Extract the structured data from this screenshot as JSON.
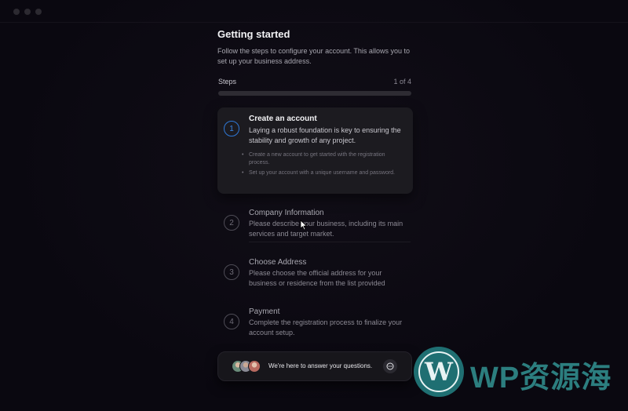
{
  "window": {
    "controls": [
      "close",
      "minimize",
      "maximize"
    ]
  },
  "header": {
    "title": "Getting started",
    "description": "Follow the steps to configure your account. This allows you to set up your business address."
  },
  "progress": {
    "label": "Steps",
    "count_text": "1 of 4",
    "current": 1,
    "total": 4,
    "fraction": 0.0
  },
  "steps": [
    {
      "number": "1",
      "title": "Create an account",
      "description": "Laying a robust foundation is key to ensuring the stability and growth of any project.",
      "bullets": [
        "Create a new account to get started with the registration process.",
        "Set up your account with a unique username and password."
      ],
      "active": true
    },
    {
      "number": "2",
      "title": "Company Information",
      "description": "Please describe your business, including its main services and target market.",
      "active": false
    },
    {
      "number": "3",
      "title": "Choose Address",
      "description": "Please choose the official address for your business or residence from the list provided",
      "active": false
    },
    {
      "number": "4",
      "title": "Payment",
      "description": "Complete the registration process to finalize your account setup.",
      "active": false
    }
  ],
  "help": {
    "text": "We're here to answer your questions.",
    "icon": "chat-bubble-icon"
  },
  "watermark": {
    "text": "WP资源海",
    "logo_letter": "W"
  },
  "colors": {
    "accent": "#2f78d6",
    "background": "#0b0910",
    "card": "#1c1b20",
    "watermark": "#2c7e7f"
  }
}
